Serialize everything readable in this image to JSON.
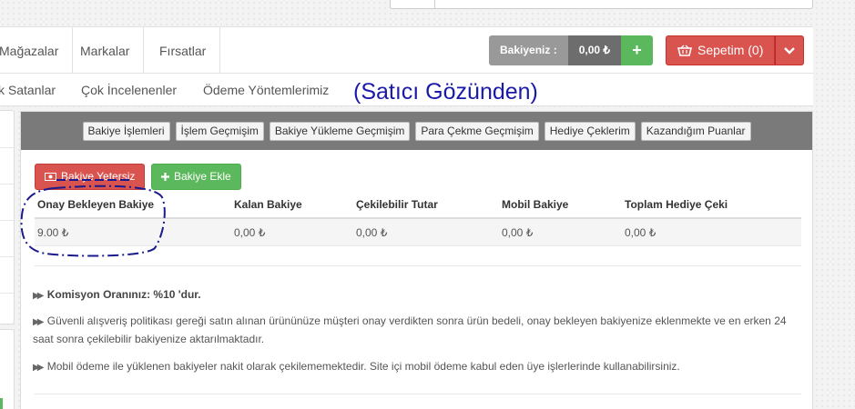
{
  "nav": {
    "items": [
      "Mağazalar",
      "Markalar",
      "Fırsatlar"
    ]
  },
  "balance": {
    "label": "Bakiyeniz :",
    "value": "0,00 ₺",
    "add_symbol": "+"
  },
  "cart": {
    "label": "Sepetim (0)"
  },
  "subnav": {
    "items": [
      "k Satanlar",
      "Çok İncelenenler",
      "Ödeme Yöntemlerimiz"
    ]
  },
  "annotation": {
    "title": "(Satıcı Gözünden)"
  },
  "panel": {
    "tabs": [
      "Bakiye İşlemleri",
      "İşlem Geçmişim",
      "Bakiye Yükleme Geçmişim",
      "Para Çekme Geçmişim",
      "Hediye Çeklerim",
      "Kazandığım Puanlar"
    ],
    "insufficient_label": "Bakiye Yetersiz",
    "add_balance_label": "Bakiye Ekle",
    "table": {
      "headers": [
        "Onay Bekleyen Bakiye",
        "Kalan Bakiye",
        "Çekilebilir Tutar",
        "Mobil Bakiye",
        "Toplam Hediye Çeki"
      ],
      "row": [
        "9.00 ₺",
        "0,00 ₺",
        "0,00 ₺",
        "0,00 ₺",
        "0,00 ₺"
      ]
    },
    "info": {
      "commission": "Komisyon Oranınız: %10 'dur.",
      "policy": "Güvenli alışveriş politikası gereği satın alınan ürününüze müşteri onay verdikten sonra ürün bedeli, onay bekleyen bakiyenize eklenmekte ve en erken 24 saat sonra çekilebilir bakiyenize aktarılmaktadır.",
      "mobile": "Mobil ödeme ile yüklenen bakiyeler nakit olarak çekilememektedir. Site içi mobil ödeme kabul eden üye işlerlerinde kullanabilirsiniz."
    }
  },
  "colors": {
    "accent_red": "#d9534f",
    "accent_green": "#5cb85c",
    "annotation_blue": "#1a1aa8"
  }
}
